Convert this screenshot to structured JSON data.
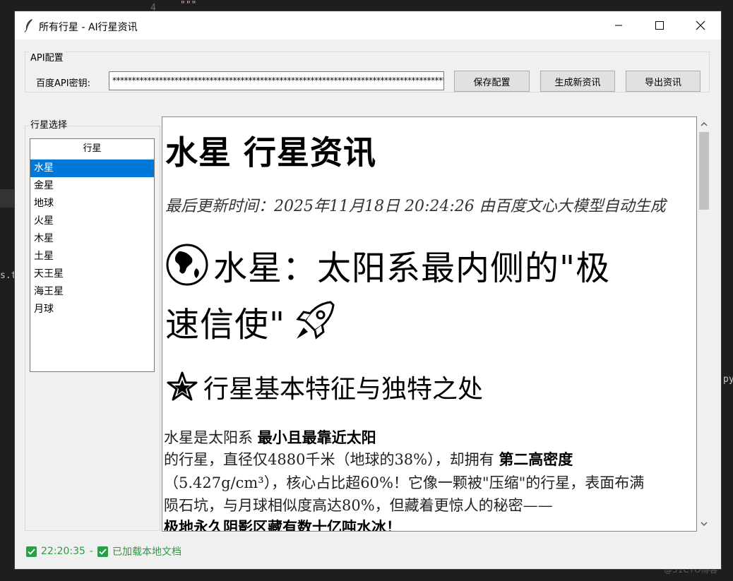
{
  "background": {
    "line_number": "4",
    "code_quote": "\"\"\"",
    "file_frag": "s.tx",
    "right_frag": "py",
    "watermark": "@51CTO博客"
  },
  "window": {
    "title": "所有行星 - AI行星资讯"
  },
  "api_config": {
    "legend": "API配置",
    "key_label": "百度API密钥:",
    "key_value": "**************************************************************************************",
    "buttons": {
      "save": "保存配置",
      "generate": "生成新资讯",
      "export": "导出资讯"
    }
  },
  "planet_select": {
    "legend": "行星选择",
    "header": "行星",
    "items": [
      "水星",
      "金星",
      "地球",
      "火星",
      "木星",
      "土星",
      "天王星",
      "海王星",
      "月球"
    ],
    "selected_index": 0
  },
  "content": {
    "title": "水星 行星资讯",
    "meta": "最后更新时间：2025年11月18日 20:24:26 由百度文心大模型自动生成",
    "heading_line1": "水星：太阳系最内侧的\"极",
    "heading_line2": "速信使\"",
    "subheading": "行星基本特征与独特之处",
    "p1_a": "水星是太阳系",
    "p1_b": "最小且最靠近太阳",
    "p2_a": "的行星，直径仅4880千米（地球的38%），却拥有",
    "p2_b": "第二高密度",
    "p3": "（5.427g/cm³），核心占比超60%！它像一颗被\"压缩\"的行星，表面布满",
    "p4": "陨石坑，与月球相似度高达80%，但藏着更惊人的秘密——",
    "p5": "极地永久阴影区藏有数十亿吨水冰！"
  },
  "status": {
    "time": "22:20:35",
    "separator": "-",
    "message": "已加载本地文档",
    "color": "#2e9a45"
  },
  "icons": {
    "title": "feather-icon",
    "globe": "globe-africa-icon",
    "rocket": "rocket-icon",
    "star": "sparkle-star-icon"
  }
}
